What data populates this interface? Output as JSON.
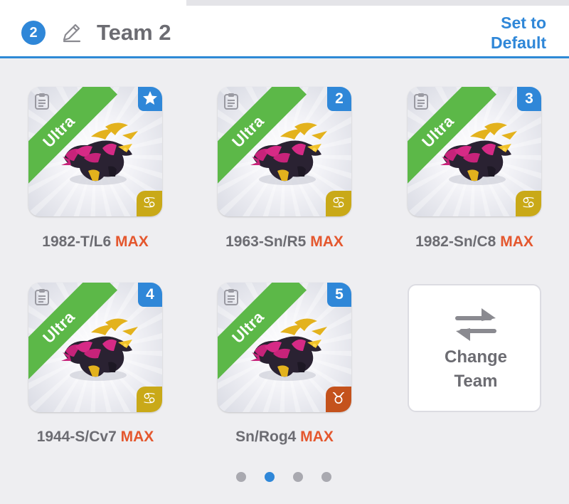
{
  "header": {
    "team_number": "2",
    "team_name": "Team 2",
    "set_default_label": "Set to Default",
    "accent": "#2f87d8"
  },
  "cards": [
    {
      "rarity": "Ultra",
      "badge": "star",
      "zodiac": "cancer",
      "zodiac_glyph": "♋",
      "name": "1982-T/L6",
      "level": "MAX"
    },
    {
      "rarity": "Ultra",
      "badge": "2",
      "zodiac": "cancer",
      "zodiac_glyph": "♋",
      "name": "1963-Sn/R5",
      "level": "MAX"
    },
    {
      "rarity": "Ultra",
      "badge": "3",
      "zodiac": "cancer",
      "zodiac_glyph": "♋",
      "name": "1982-Sn/C8",
      "level": "MAX"
    },
    {
      "rarity": "Ultra",
      "badge": "4",
      "zodiac": "cancer",
      "zodiac_glyph": "♋",
      "name": "1944-S/Cv7",
      "level": "MAX"
    },
    {
      "rarity": "Ultra",
      "badge": "5",
      "zodiac": "taurus",
      "zodiac_glyph": "♉",
      "name": "Sn/Rog4",
      "level": "MAX"
    }
  ],
  "change_team": {
    "label_line1": "Change",
    "label_line2": "Team"
  },
  "pagination": {
    "pages": 4,
    "current": 2
  },
  "colors": {
    "ultra_ribbon": "#5cb848",
    "max_text": "#e4572e",
    "cancer_badge": "#c9a918",
    "taurus_badge": "#c4521c"
  }
}
